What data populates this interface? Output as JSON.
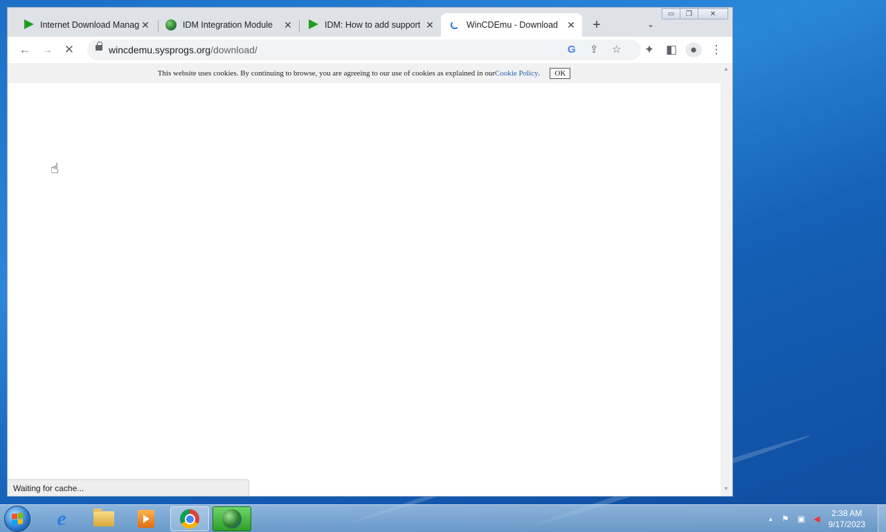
{
  "browser": {
    "tabs": [
      {
        "title": "Internet Download Manag",
        "close": "✕"
      },
      {
        "title": "IDM Integration Module",
        "close": "✕"
      },
      {
        "title": "IDM: How to add support",
        "close": "✕"
      },
      {
        "title": "WinCDEmu - Download",
        "close": "✕"
      }
    ],
    "new_tab": "+",
    "tab_list": "⌄",
    "window_controls": {
      "minimize": "▭",
      "restore": "❐",
      "close": "✕"
    },
    "nav": {
      "back": "←",
      "forward": "→",
      "stop": "✕"
    },
    "url": {
      "host": "wincdemu.sysprogs.org",
      "path": "/download/"
    },
    "omnibox_icons": {
      "google": "G",
      "share": "⇪",
      "bookmark": "☆"
    },
    "toolbar_icons": {
      "extensions": "✦",
      "side_panel": "◧",
      "profile": "●",
      "menu": "⋮"
    }
  },
  "page": {
    "cookie_text": "This website uses cookies. By continuing to browse, you are agreeing to our use of cookies as explained in our ",
    "cookie_link": "Cookie Policy",
    "cookie_period": ".",
    "ok_label": "OK",
    "status": "Waiting for cache..."
  },
  "taskbar": {
    "clock_time": "2:38 AM",
    "clock_date": "9/17/2023",
    "tray_expand": "▲",
    "tray_flag": "⚑",
    "tray_network": "▣",
    "tray_volume": "◀"
  }
}
